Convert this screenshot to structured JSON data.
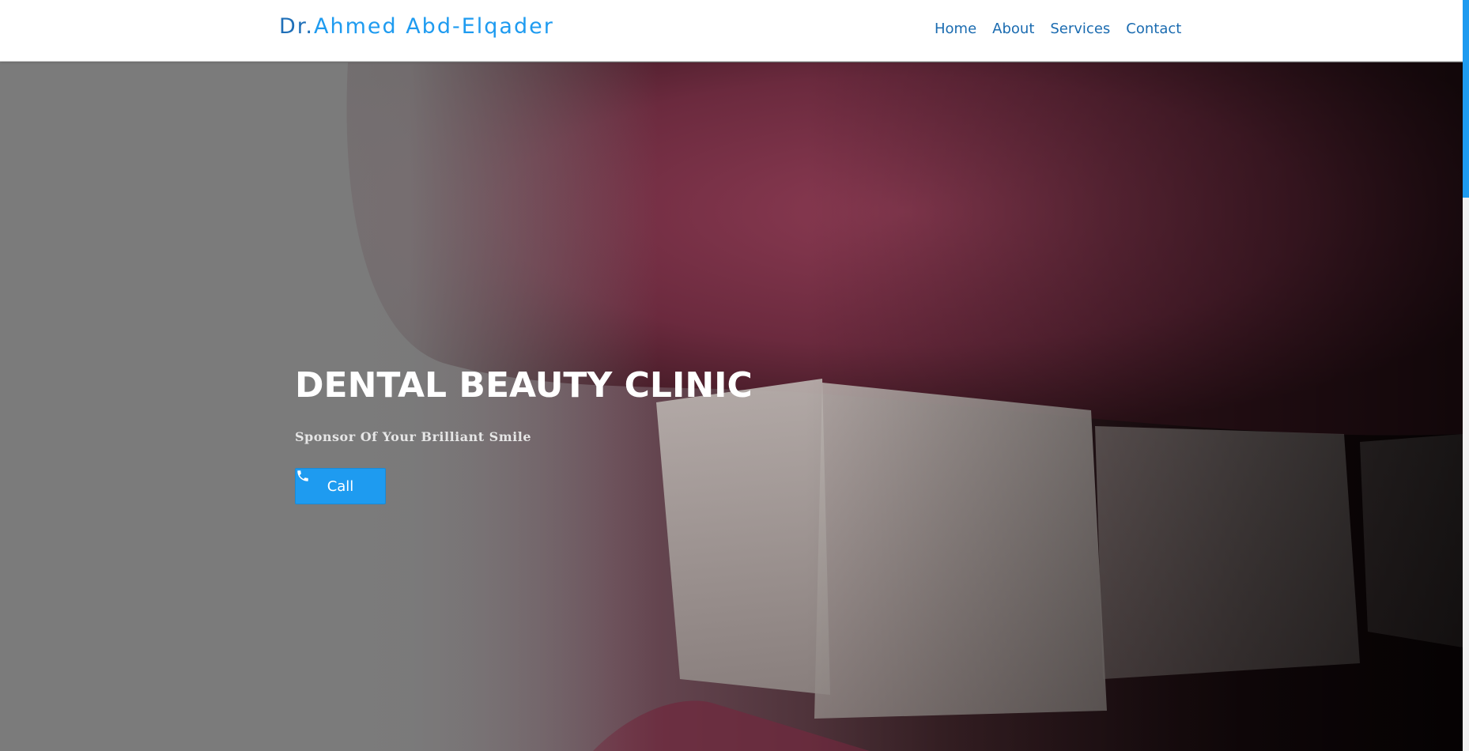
{
  "navbar": {
    "brand_prefix": "Dr.",
    "brand_name": "Ahmed Abd-Elqader",
    "links": [
      {
        "label": "Home"
      },
      {
        "label": "About"
      },
      {
        "label": "Services"
      },
      {
        "label": "Contact"
      }
    ]
  },
  "hero": {
    "title": "DENTAL BEAUTY CLINIC",
    "subtitle": "Sponsor Of Your Brilliant Smile",
    "call_label": "Call",
    "call_icon": "phone-icon"
  },
  "colors": {
    "accent": "#1e9bf0",
    "brand_dark": "#1f6fb8",
    "nav_link": "#1a6bb0"
  }
}
